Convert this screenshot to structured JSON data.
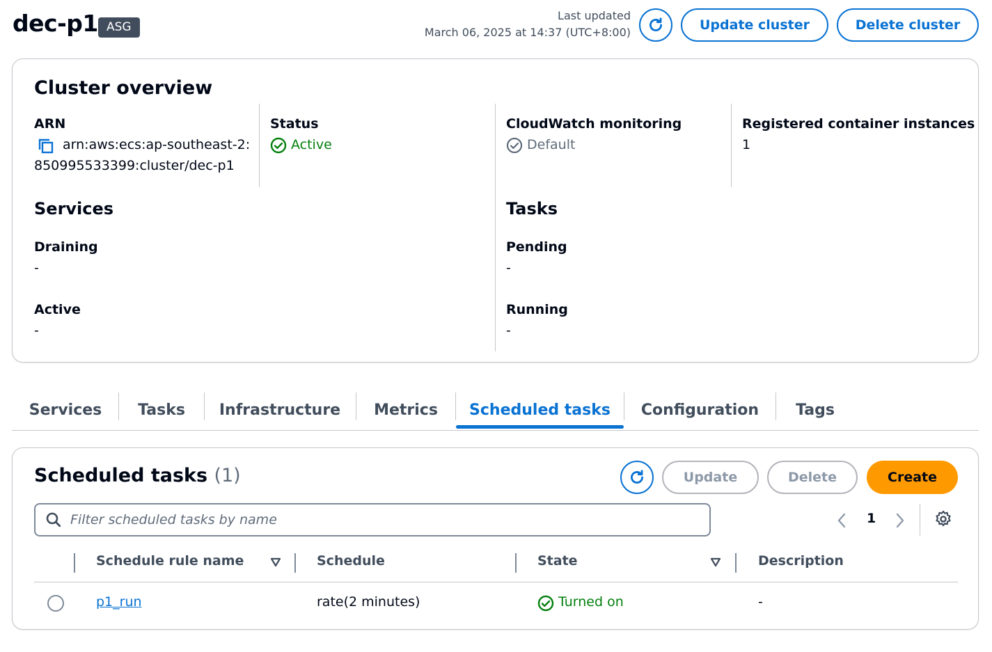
{
  "header": {
    "title": "dec-p1",
    "badge": "ASG",
    "last_updated_label": "Last updated",
    "last_updated_time": "March 06, 2025 at 14:37 (UTC+8:00)",
    "update_cluster_label": "Update cluster",
    "delete_cluster_label": "Delete cluster"
  },
  "overview": {
    "title": "Cluster overview",
    "arn_label": "ARN",
    "arn_line1": "arn:aws:ecs:ap-southeast-2:",
    "arn_line2": "850995533399:cluster/dec-p1",
    "status_label": "Status",
    "status_value": "Active",
    "cloudwatch_label": "CloudWatch monitoring",
    "cloudwatch_value": "Default",
    "registered_label": "Registered container instances",
    "registered_value": "1",
    "services_title": "Services",
    "draining_label": "Draining",
    "draining_value": "-",
    "active_label": "Active",
    "active_value": "-",
    "tasks_title": "Tasks",
    "pending_label": "Pending",
    "pending_value": "-",
    "running_label": "Running",
    "running_value": "-"
  },
  "tabs": [
    {
      "label": "Services"
    },
    {
      "label": "Tasks"
    },
    {
      "label": "Infrastructure"
    },
    {
      "label": "Metrics"
    },
    {
      "label": "Scheduled tasks",
      "active": true
    },
    {
      "label": "Configuration"
    },
    {
      "label": "Tags"
    }
  ],
  "scheduled": {
    "title": "Scheduled tasks",
    "count": "(1)",
    "update_label": "Update",
    "delete_label": "Delete",
    "create_label": "Create",
    "search_placeholder": "Filter scheduled tasks by name",
    "page": "1",
    "columns": {
      "name": "Schedule rule name",
      "schedule": "Schedule",
      "state": "State",
      "description": "Description"
    },
    "rows": [
      {
        "name": "p1_run",
        "schedule": "rate(2 minutes)",
        "state": "Turned on",
        "description": "-"
      }
    ]
  },
  "colors": {
    "accent": "#0972d3",
    "success": "#037f0c",
    "primary_button": "#ff9900",
    "badge_bg": "#414d5c"
  },
  "icons": {
    "refresh": "refresh-icon",
    "copy": "copy-icon",
    "status_ok": "check-circle-icon",
    "search": "search-icon",
    "settings": "gear-icon",
    "sort": "caret-down-icon"
  }
}
